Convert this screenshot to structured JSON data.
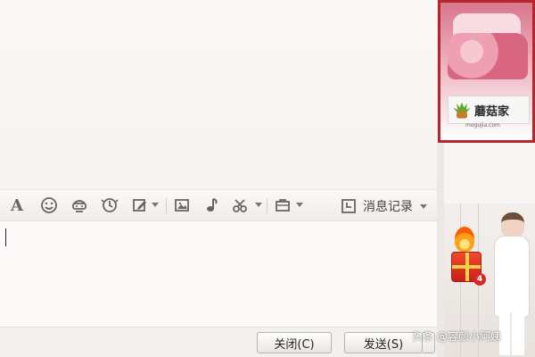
{
  "toolbar": {
    "icons": [
      {
        "name": "font-icon"
      },
      {
        "name": "emoji-icon"
      },
      {
        "name": "magic-expression-icon"
      },
      {
        "name": "shake-icon"
      },
      {
        "name": "edit-icon"
      },
      {
        "name": "image-icon"
      },
      {
        "name": "music-icon"
      },
      {
        "name": "scissors-icon"
      },
      {
        "name": "briefcase-icon"
      }
    ],
    "history_label": "消息记录"
  },
  "buttons": {
    "close_label": "关闭(C)",
    "send_label": "发送(S)"
  },
  "ads": {
    "brand": "蘑菇家",
    "site": "mogujia.com"
  },
  "avatar": {
    "badge_count": "4"
  },
  "watermark": {
    "text": "头条 @容颜小阿姨"
  },
  "colors": {
    "window_bg": "#f7f4f2",
    "accent_red": "#b7262b"
  }
}
